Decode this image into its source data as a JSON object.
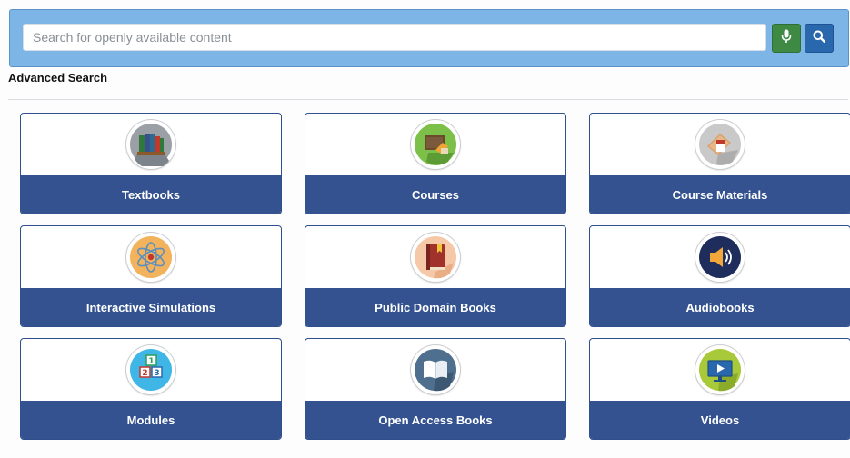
{
  "search": {
    "placeholder": "Search for openly available content",
    "value": ""
  },
  "advanced_search_label": "Advanced Search",
  "colors": {
    "search_bar_bg": "#7db6e6",
    "mic_button_bg": "#3e8a44",
    "search_button_bg": "#2a68ad",
    "card_band_bg": "#33528f",
    "card_border": "#2f4f8d"
  },
  "categories": [
    {
      "label": "Textbooks",
      "icon": "textbooks-icon"
    },
    {
      "label": "Courses",
      "icon": "courses-icon"
    },
    {
      "label": "Course Materials",
      "icon": "course-materials-icon"
    },
    {
      "label": "Interactive Simulations",
      "icon": "atom-icon"
    },
    {
      "label": "Public Domain Books",
      "icon": "book-icon"
    },
    {
      "label": "Audiobooks",
      "icon": "speaker-icon"
    },
    {
      "label": "Modules",
      "icon": "blocks-icon"
    },
    {
      "label": "Open Access Books",
      "icon": "open-book-icon"
    },
    {
      "label": "Videos",
      "icon": "video-monitor-icon"
    }
  ]
}
